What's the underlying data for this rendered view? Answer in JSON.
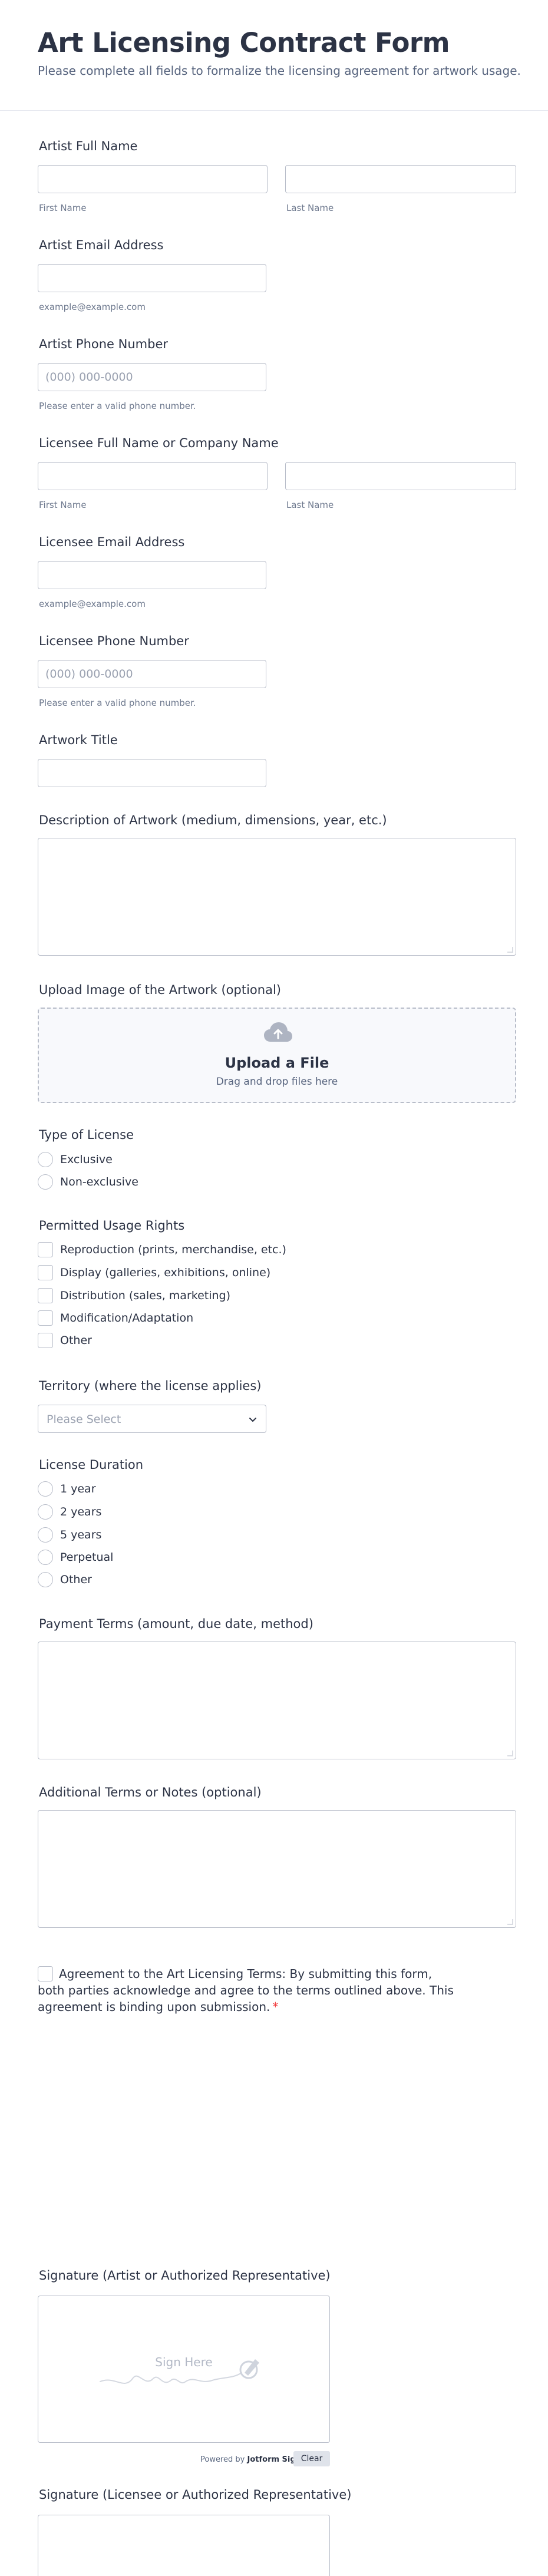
{
  "header": {
    "title": "Art Licensing Contract Form",
    "subtitle": "Please complete all fields to formalize the licensing agreement for artwork usage."
  },
  "artist_name": {
    "label": "Artist Full Name",
    "first_sublabel": "First Name",
    "last_sublabel": "Last Name"
  },
  "artist_email": {
    "label": "Artist Email Address",
    "sublabel": "example@example.com"
  },
  "artist_phone": {
    "label": "Artist Phone Number",
    "placeholder": "(000) 000-0000",
    "sublabel": "Please enter a valid phone number."
  },
  "licensee_name": {
    "label": "Licensee Full Name or Company Name",
    "first_sublabel": "First Name",
    "last_sublabel": "Last Name"
  },
  "licensee_email": {
    "label": "Licensee Email Address",
    "sublabel": "example@example.com"
  },
  "licensee_phone": {
    "label": "Licensee Phone Number",
    "placeholder": "(000) 000-0000",
    "sublabel": "Please enter a valid phone number."
  },
  "artwork_title": {
    "label": "Artwork Title"
  },
  "description": {
    "label": "Description of Artwork (medium, dimensions, year, etc.)"
  },
  "upload": {
    "label": "Upload Image of the Artwork (optional)",
    "title": "Upload a File",
    "subtitle": "Drag and drop files here",
    "icon": "cloud-upload-icon"
  },
  "license_type": {
    "label": "Type of License",
    "options": [
      "Exclusive",
      "Non-exclusive"
    ]
  },
  "usage_rights": {
    "label": "Permitted Usage Rights",
    "options": [
      "Reproduction (prints, merchandise, etc.)",
      "Display (galleries, exhibitions, online)",
      "Distribution (sales, marketing)",
      "Modification/Adaptation",
      "Other"
    ]
  },
  "territory": {
    "label": "Territory (where the license applies)",
    "selected": "Please Select"
  },
  "duration": {
    "label": "License Duration",
    "options": [
      "1 year",
      "2 years",
      "5 years",
      "Perpetual",
      "Other"
    ]
  },
  "payment": {
    "label": "Payment Terms (amount, due date, method)"
  },
  "notes": {
    "label": "Additional Terms or Notes (optional)"
  },
  "agreement": {
    "text": "Agreement to the Art Licensing Terms: By submitting this form, both parties acknowledge and agree to the terms outlined above. This agreement is binding upon submission.",
    "required_mark": "*"
  },
  "signature_artist": {
    "label": "Signature (Artist or Authorized Representative)",
    "placeholder": "Sign Here",
    "powered_prefix": "Powered by",
    "powered_brand": "Jotform Sign",
    "clear_label": "Clear"
  },
  "signature_licensee": {
    "label": "Signature (Licensee or Authorized Representative)"
  },
  "colors": {
    "text": "#2c3345",
    "border": "#b8bdc9",
    "required": "#f23a3c",
    "muted": "#6f7a8f"
  }
}
